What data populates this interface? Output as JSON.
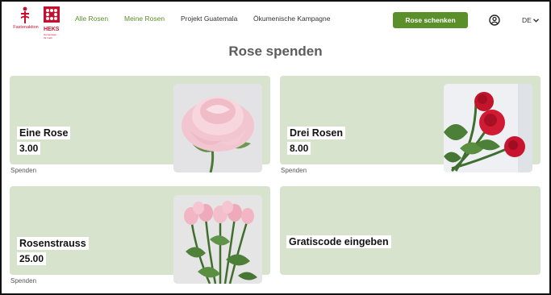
{
  "header": {
    "logo_fastenaktion": "Fastenaktion",
    "logo_heks": "HEKS",
    "logo_heks_sub": "Gemeinsam für mehr",
    "nav": [
      {
        "label": "Alle Rosen"
      },
      {
        "label": "Meine Rosen"
      },
      {
        "label": "Projekt Guatemala"
      },
      {
        "label": "Ökumenische Kampagne"
      }
    ],
    "cta_label": "Rose schenken",
    "language": "DE"
  },
  "page_title": "Rose spenden",
  "cards": [
    {
      "name": "Eine Rose",
      "price": "3.00",
      "action": "Spenden",
      "image": "single-pink-rose"
    },
    {
      "name": "Drei Rosen",
      "price": "8.00",
      "action": "Spenden",
      "image": "three-red-roses"
    },
    {
      "name": "Rosenstrauss",
      "price": "25.00",
      "action": "Spenden",
      "image": "pink-rose-bouquet"
    },
    {
      "name": "Gratiscode eingeben"
    }
  ],
  "colors": {
    "brand_green": "#5a8f29",
    "card_bg": "#d7e3cc",
    "brand_red": "#c8102e"
  }
}
